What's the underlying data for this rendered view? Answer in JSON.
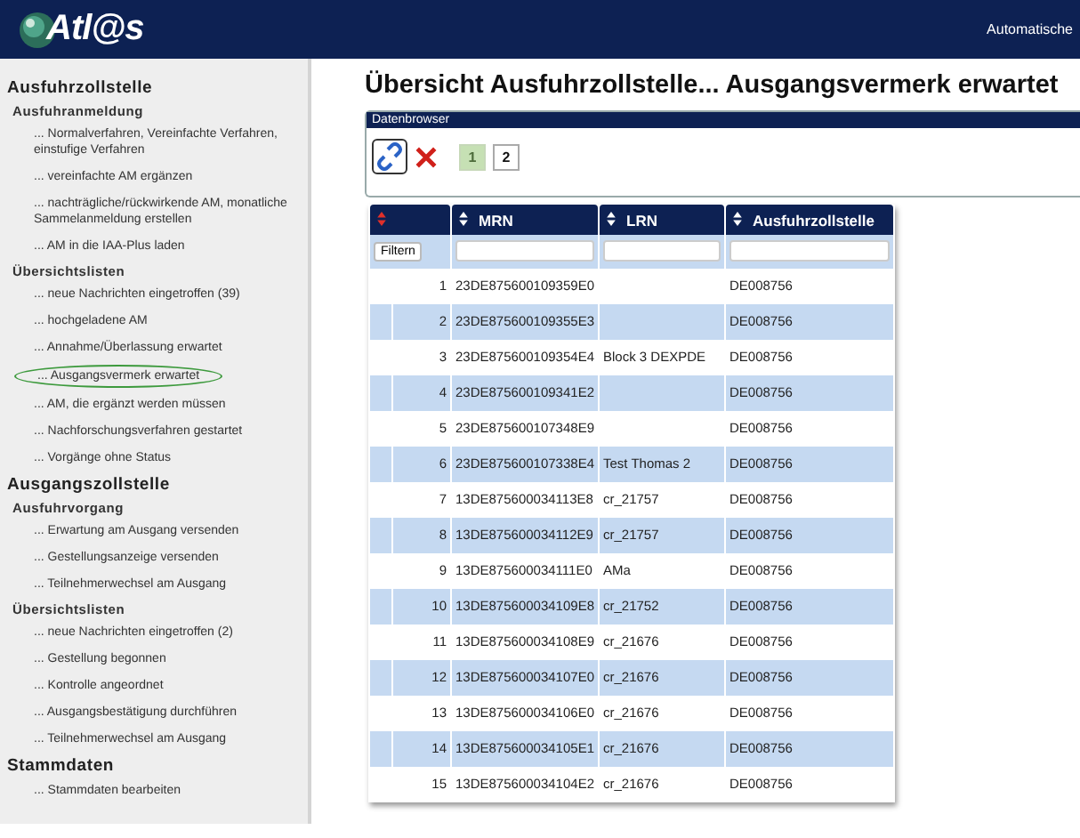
{
  "header": {
    "logo": "Atl@s",
    "right_text": "Automatische"
  },
  "sidebar": {
    "sections": [
      {
        "title": "Ausfuhrzollstelle",
        "groups": [
          {
            "title": "Ausfuhranmeldung",
            "items": [
              {
                "label": "... Normalverfahren, Vereinfachte Verfahren, einstufige Verfahren",
                "circled": false
              },
              {
                "label": "... vereinfachte AM ergänzen",
                "circled": false
              },
              {
                "label": "... nachträgliche/rückwirkende AM, monatliche Sammelanmeldung erstellen",
                "circled": false
              },
              {
                "label": "... AM in die IAA-Plus laden",
                "circled": false
              }
            ]
          },
          {
            "title": "Übersichtslisten",
            "items": [
              {
                "label": "... neue Nachrichten eingetroffen (39)",
                "circled": false
              },
              {
                "label": "... hochgeladene AM",
                "circled": false
              },
              {
                "label": "... Annahme/Überlassung erwartet",
                "circled": false
              },
              {
                "label": "... Ausgangsvermerk erwartet",
                "circled": true
              },
              {
                "label": "... AM, die ergänzt werden müssen",
                "circled": false
              },
              {
                "label": "... Nachforschungsverfahren gestartet",
                "circled": false
              },
              {
                "label": "... Vorgänge ohne Status",
                "circled": false
              }
            ]
          }
        ]
      },
      {
        "title": "Ausgangszollstelle",
        "groups": [
          {
            "title": "Ausfuhrvorgang",
            "items": [
              {
                "label": "... Erwartung am Ausgang versenden",
                "circled": false
              },
              {
                "label": "... Gestellungsanzeige versenden",
                "circled": false
              },
              {
                "label": "... Teilnehmerwechsel am Ausgang",
                "circled": false
              }
            ]
          },
          {
            "title": "Übersichtslisten",
            "items": [
              {
                "label": "... neue Nachrichten eingetroffen (2)",
                "circled": false
              },
              {
                "label": "... Gestellung begonnen",
                "circled": false
              },
              {
                "label": "... Kontrolle angeordnet",
                "circled": false
              },
              {
                "label": "... Ausgangsbestätigung durchführen",
                "circled": false
              },
              {
                "label": "... Teilnehmerwechsel am Ausgang",
                "circled": false
              }
            ]
          }
        ]
      },
      {
        "title": "Stammdaten",
        "items": [
          {
            "label": "... Stammdaten bearbeiten",
            "circled": false
          }
        ]
      }
    ]
  },
  "main": {
    "title": "Übersicht Ausfuhrzollstelle... Ausgangsvermerk erwartet",
    "browser": {
      "title": "Datenbrowser",
      "pages": [
        {
          "label": "1",
          "selected": true
        },
        {
          "label": "2",
          "selected": false
        }
      ]
    },
    "table": {
      "columns": [
        "MRN",
        "LRN",
        "Ausfuhrzollstelle"
      ],
      "filter_button": "Filtern",
      "rows": [
        {
          "number": "1",
          "mrn": "23DE875600109359E0",
          "lrn": "",
          "office": "DE008756"
        },
        {
          "number": "2",
          "mrn": "23DE875600109355E3",
          "lrn": "",
          "office": "DE008756"
        },
        {
          "number": "3",
          "mrn": "23DE875600109354E4",
          "lrn": "Block 3 DEXPDE",
          "office": "DE008756"
        },
        {
          "number": "4",
          "mrn": "23DE875600109341E2",
          "lrn": "",
          "office": "DE008756"
        },
        {
          "number": "5",
          "mrn": "23DE875600107348E9",
          "lrn": "",
          "office": "DE008756"
        },
        {
          "number": "6",
          "mrn": "23DE875600107338E4",
          "lrn": "Test Thomas 2",
          "office": "DE008756"
        },
        {
          "number": "7",
          "mrn": "13DE875600034113E8",
          "lrn": "cr_21757",
          "office": "DE008756"
        },
        {
          "number": "8",
          "mrn": "13DE875600034112E9",
          "lrn": "cr_21757",
          "office": "DE008756"
        },
        {
          "number": "9",
          "mrn": "13DE875600034111E0",
          "lrn": "AMa",
          "office": "DE008756"
        },
        {
          "number": "10",
          "mrn": "13DE875600034109E8",
          "lrn": "cr_21752",
          "office": "DE008756"
        },
        {
          "number": "11",
          "mrn": "13DE875600034108E9",
          "lrn": "cr_21676",
          "office": "DE008756"
        },
        {
          "number": "12",
          "mrn": "13DE875600034107E0",
          "lrn": "cr_21676",
          "office": "DE008756"
        },
        {
          "number": "13",
          "mrn": "13DE875600034106E0",
          "lrn": "cr_21676",
          "office": "DE008756"
        },
        {
          "number": "14",
          "mrn": "13DE875600034105E1",
          "lrn": "cr_21676",
          "office": "DE008756"
        },
        {
          "number": "15",
          "mrn": "13DE875600034104E2",
          "lrn": "cr_21676",
          "office": "DE008756"
        }
      ]
    }
  }
}
